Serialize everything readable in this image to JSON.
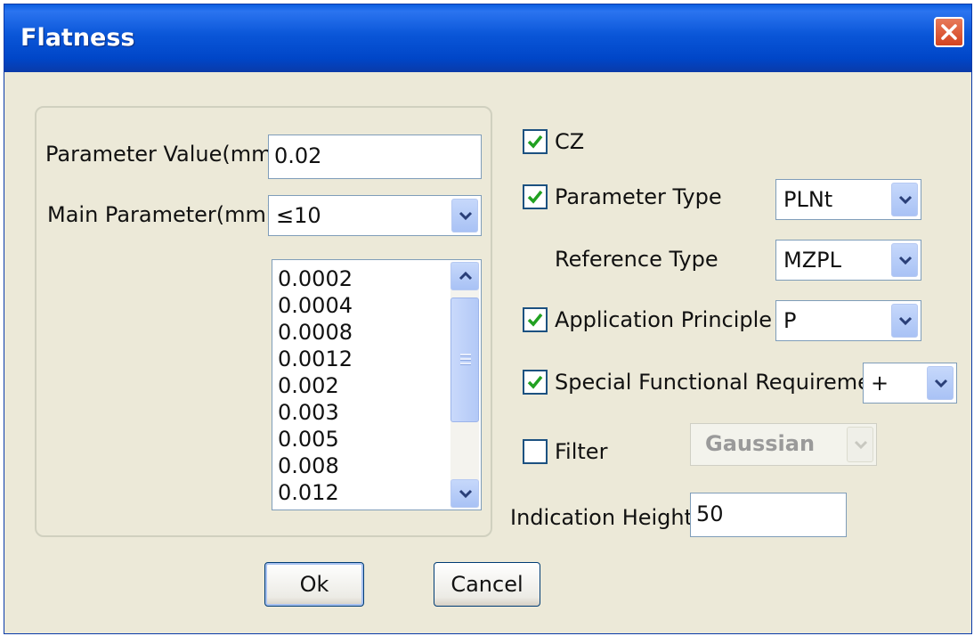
{
  "window": {
    "title": "Flatness"
  },
  "left_panel": {
    "parameter_value_label": "Parameter Value(mm)",
    "parameter_value": "0.02",
    "main_parameter_label": "Main Parameter(mm)",
    "main_parameter_value": "≤10",
    "values_list": [
      "0.0002",
      "0.0004",
      "0.0008",
      "0.0012",
      "0.002",
      "0.003",
      "0.005",
      "0.008",
      "0.012"
    ]
  },
  "right_panel": {
    "cz": {
      "label": "CZ",
      "checked": true
    },
    "parameter_type": {
      "label": "Parameter Type",
      "checked": true,
      "value": "PLNt"
    },
    "reference_type": {
      "label": "Reference Type",
      "value": "MZPL"
    },
    "application_principle": {
      "label": "Application Principle",
      "checked": true,
      "value": "P"
    },
    "special_functional_requirement": {
      "label": "Special Functional Requirement",
      "checked": true,
      "value": "+"
    },
    "filter": {
      "label": "Filter",
      "checked": false,
      "value": "Gaussian"
    },
    "indication_height": {
      "label": "Indication Height",
      "value": "50"
    }
  },
  "buttons": {
    "ok": "Ok",
    "cancel": "Cancel"
  },
  "colors": {
    "title_bar": "#0a56d8",
    "dialog_bg": "#ece9d8",
    "check_mark": "#21a121",
    "close_button": "#d4431f"
  }
}
